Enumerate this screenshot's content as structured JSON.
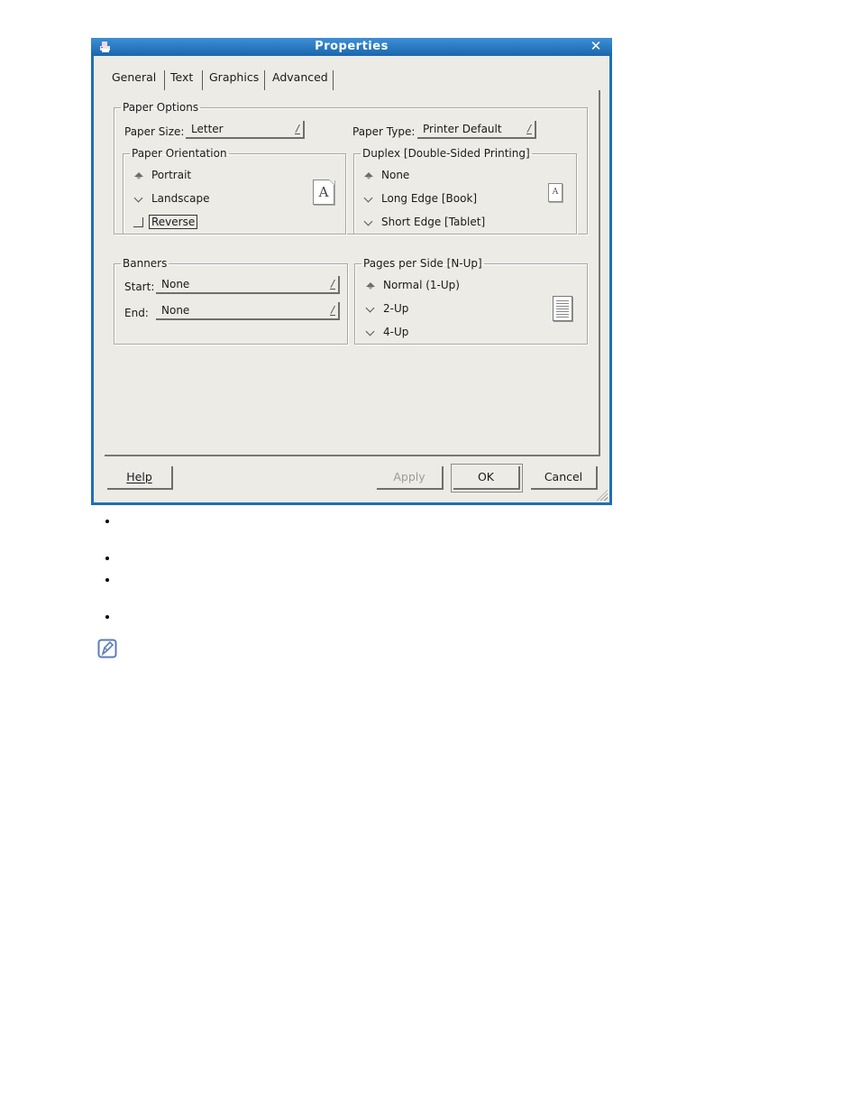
{
  "window": {
    "title": "Properties",
    "icon": "printer-app-icon",
    "close_label": "✕"
  },
  "tabs": [
    {
      "label": "General",
      "active": true
    },
    {
      "label": "Text",
      "active": false
    },
    {
      "label": "Graphics",
      "active": false
    },
    {
      "label": "Advanced",
      "active": false
    }
  ],
  "paper_options": {
    "legend": "Paper Options",
    "paper_size_label": "Paper Size:",
    "paper_size_value": "Letter",
    "paper_type_label": "Paper Type:",
    "paper_type_value": "Printer Default"
  },
  "paper_orientation": {
    "legend": "Paper Orientation",
    "options": [
      {
        "label": "Portrait",
        "selected": true
      },
      {
        "label": "Landscape",
        "selected": false
      }
    ],
    "reverse_label": "Reverse",
    "reverse_checked": false,
    "preview_glyph": "A"
  },
  "duplex": {
    "legend": "Duplex [Double-Sided Printing]",
    "options": [
      {
        "label": "None",
        "selected": true
      },
      {
        "label": "Long Edge [Book]",
        "selected": false
      },
      {
        "label": "Short Edge [Tablet]",
        "selected": false
      }
    ],
    "preview_glyph": "A"
  },
  "banners": {
    "legend": "Banners",
    "start_label": "Start:",
    "start_value": "None",
    "end_label": "End:",
    "end_value": "None"
  },
  "nup": {
    "legend": "Pages per Side [N-Up]",
    "options": [
      {
        "label": "Normal (1-Up)",
        "selected": true
      },
      {
        "label": "2-Up",
        "selected": false
      },
      {
        "label": "4-Up",
        "selected": false
      }
    ]
  },
  "buttons": {
    "help": "Help",
    "apply": "Apply",
    "ok": "OK",
    "cancel": "Cancel"
  },
  "colors": {
    "titlebar": "#1f6fb4",
    "dialog_bg": "#edebe6",
    "note_icon": "#5b7cb8"
  }
}
